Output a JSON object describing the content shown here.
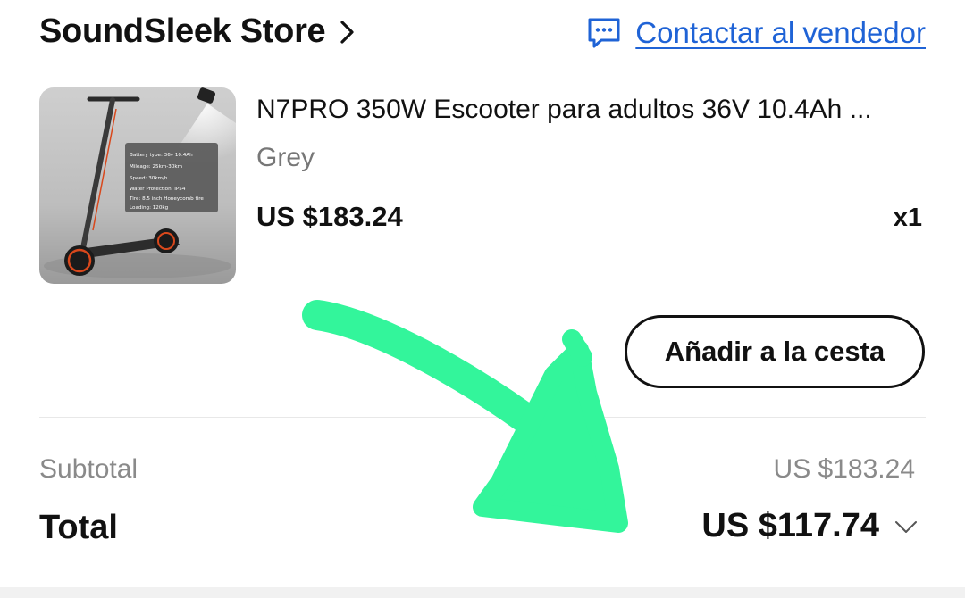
{
  "store": {
    "name": "SoundSleek Store",
    "contact_label": "Contactar al vendedor"
  },
  "item": {
    "title": "N7PRO 350W Escooter para adultos 36V 10.4Ah ...",
    "variant": "Grey",
    "price": "US $183.24",
    "quantity": "x1",
    "image_specs": [
      "Battery type: 36v 10.4Ah",
      "Mileage: 25km-30km",
      "Speed: 30km/h",
      "Water Protection: IP54",
      "Tire: 8.5 inch Honeycomb tire",
      "Loading: 120kg"
    ]
  },
  "actions": {
    "add_to_cart": "Añadir a la cesta"
  },
  "summary": {
    "subtotal_label": "Subtotal",
    "subtotal_value": "US $183.24",
    "total_label": "Total",
    "total_value": "US $117.74"
  },
  "colors": {
    "link": "#1f63d6",
    "annotation": "#33f59b"
  },
  "icons": {
    "store_chevron": "chevron-right-icon",
    "contact": "chat-icon",
    "total_expand": "chevron-down-icon"
  }
}
